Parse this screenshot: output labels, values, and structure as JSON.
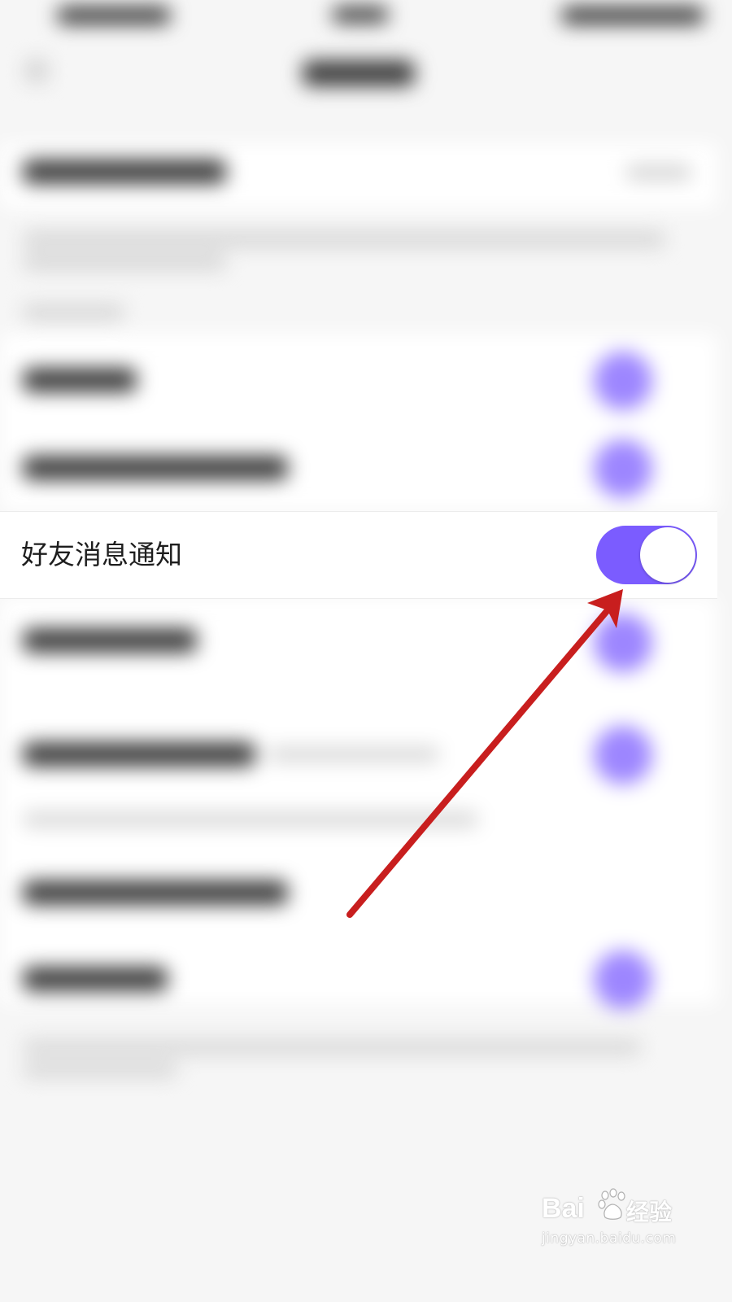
{
  "setting_row": {
    "label": "好友消息通知",
    "toggle_on": true
  },
  "colors": {
    "accent": "#7b5cff",
    "arrow": "#c81e1e",
    "background": "#f6f6f6"
  },
  "watermark": {
    "logo_text": "Bai",
    "logo_suffix": "经验",
    "url": "jingyan.baidu.com"
  },
  "icons": {
    "annotation": "red-arrow-icon",
    "watermark_paw": "baidu-paw-icon"
  }
}
